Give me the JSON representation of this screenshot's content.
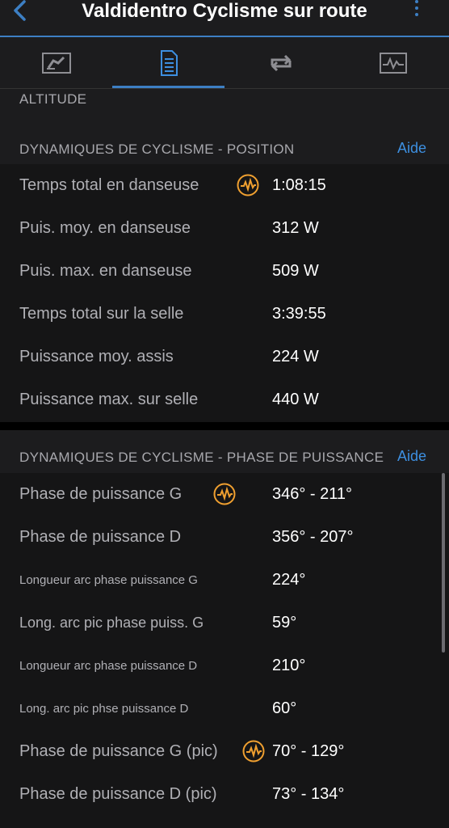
{
  "header": {
    "title": "Valdidentro Cyclisme sur route"
  },
  "tabs": [
    {
      "name": "tab-overview",
      "icon": "speed-gauge-icon"
    },
    {
      "name": "tab-details",
      "icon": "document-icon"
    },
    {
      "name": "tab-laps",
      "icon": "loop-icon"
    },
    {
      "name": "tab-charts",
      "icon": "chart-icon"
    }
  ],
  "sections": {
    "altitude_label": "ALTITUDE",
    "position": {
      "label": "DYNAMIQUES DE CYCLISME - POSITION",
      "help": "Aide",
      "rows": [
        {
          "label": "Temps total en danseuse",
          "value": "1:08:15"
        },
        {
          "label": "Puis. moy. en danseuse",
          "value": "312 W"
        },
        {
          "label": "Puis. max. en danseuse",
          "value": "509 W"
        },
        {
          "label": "Temps total sur la selle",
          "value": "3:39:55"
        },
        {
          "label": "Puissance moy. assis",
          "value": "224 W"
        },
        {
          "label": "Puissance max. sur selle",
          "value": "440 W"
        }
      ]
    },
    "power_phase": {
      "label": "DYNAMIQUES DE CYCLISME - PHASE DE PUISSANCE",
      "help": "Aide",
      "rows": [
        {
          "label": "Phase de puissance G",
          "value": "346° - 211°"
        },
        {
          "label": "Phase de puissance D",
          "value": "356° - 207°"
        },
        {
          "label": "Longueur arc phase puissance G",
          "value": "224°"
        },
        {
          "label": "Long. arc pic phase puiss. G",
          "value": "59°"
        },
        {
          "label": "Longueur arc phase puissance D",
          "value": "210°"
        },
        {
          "label": "Long. arc pic phse puissance D",
          "value": "60°"
        },
        {
          "label": "Phase de puissance G (pic)",
          "value": "70° - 129°"
        },
        {
          "label": "Phase de puissance D (pic)",
          "value": "73° - 134°"
        }
      ]
    }
  },
  "colors": {
    "accent": "#3d7fc4",
    "badge": "#f0a030"
  }
}
